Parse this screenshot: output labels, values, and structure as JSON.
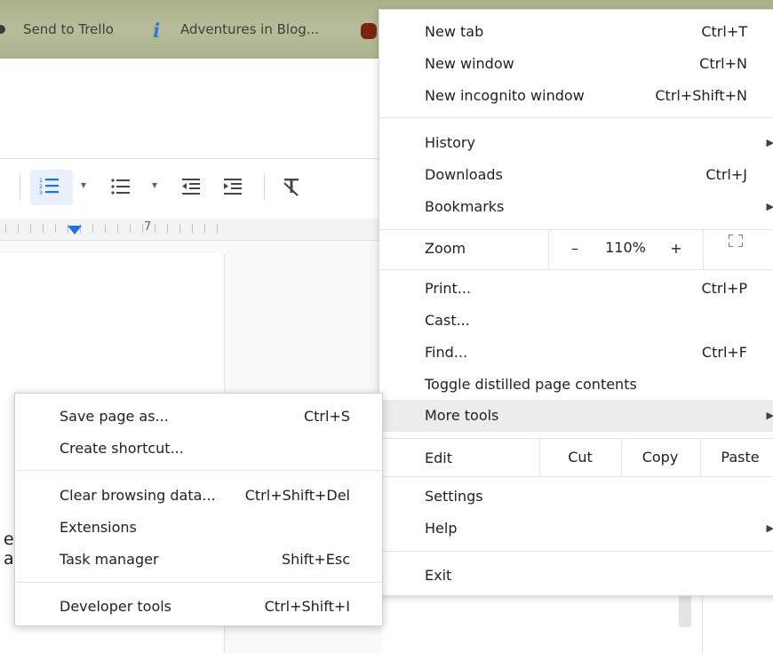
{
  "bookmarks": {
    "items": [
      {
        "label": "Send to Trello"
      },
      {
        "label": "Adventures in Blog..."
      }
    ]
  },
  "doc": {
    "ruler_number": "7",
    "text_fragments": [
      "e",
      "a"
    ]
  },
  "menu": {
    "new_tab": {
      "label": "New tab",
      "shortcut": "Ctrl+T"
    },
    "new_window": {
      "label": "New window",
      "shortcut": "Ctrl+N"
    },
    "new_incognito": {
      "label": "New incognito window",
      "shortcut": "Ctrl+Shift+N"
    },
    "history": {
      "label": "History"
    },
    "downloads": {
      "label": "Downloads",
      "shortcut": "Ctrl+J"
    },
    "bookmarks": {
      "label": "Bookmarks"
    },
    "zoom": {
      "label": "Zoom",
      "minus": "–",
      "value": "110%",
      "plus": "+"
    },
    "print": {
      "label": "Print...",
      "shortcut": "Ctrl+P"
    },
    "cast": {
      "label": "Cast..."
    },
    "find": {
      "label": "Find...",
      "shortcut": "Ctrl+F"
    },
    "toggle_distilled": {
      "label": "Toggle distilled page contents"
    },
    "more_tools": {
      "label": "More tools"
    },
    "edit": {
      "label": "Edit",
      "cut": "Cut",
      "copy": "Copy",
      "paste": "Paste"
    },
    "settings": {
      "label": "Settings"
    },
    "help": {
      "label": "Help"
    },
    "exit": {
      "label": "Exit"
    }
  },
  "submenu": {
    "save_page": {
      "label": "Save page as...",
      "shortcut": "Ctrl+S"
    },
    "create_shortcut": {
      "label": "Create shortcut..."
    },
    "clear_browsing": {
      "label": "Clear browsing data...",
      "shortcut": "Ctrl+Shift+Del"
    },
    "extensions": {
      "label": "Extensions"
    },
    "task_manager": {
      "label": "Task manager",
      "shortcut": "Shift+Esc"
    },
    "developer_tools": {
      "label": "Developer tools",
      "shortcut": "Ctrl+Shift+I"
    }
  },
  "colors": {
    "hover": "#ececec",
    "accent_blue": "#1a73e8",
    "bookmarks_bar": "#b2b893"
  },
  "icons": {
    "submenu_arrow": "▶",
    "toolbar_caret": "▾"
  }
}
